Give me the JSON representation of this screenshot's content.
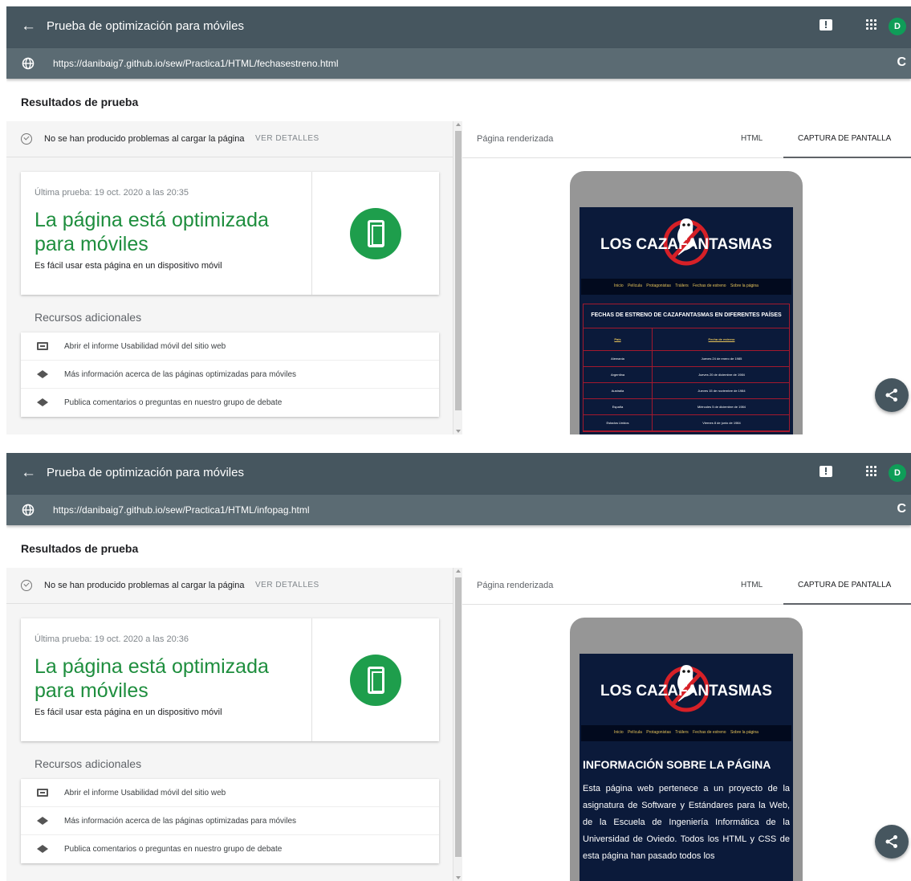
{
  "common": {
    "back_glyph": "←",
    "app_title": "Prueba de optimización para móviles",
    "avatar_letter": "D",
    "results_heading": "Resultados de prueba",
    "status_message": "No se han producido problemas al cargar la página",
    "details_link": "VER DETALLES",
    "headline": "La página está optimizada para móviles",
    "subline": "Es fácil usar esta página en un dispositivo móvil",
    "resources_heading": "Recursos adicionales",
    "resource_links": [
      "Abrir el informe Usabilidad móvil del sitio web",
      "Más información acerca de las páginas optimizadas para móviles",
      "Publica comentarios o preguntas en nuestro grupo de debate"
    ],
    "rendered_label": "Página renderizada",
    "tabs": [
      "HTML",
      "CAPTURA DE PANTALLA"
    ],
    "site_title": "LOS CAZAFANTASMAS",
    "site_nav": [
      "Inicio",
      "Película",
      "Protagonistas",
      "Tráilers",
      "Fechas de estreno",
      "Sobre la página"
    ],
    "reload_glyph": "C"
  },
  "captures": [
    {
      "url": "https://danibaig7.github.io/sew/Practica1/HTML/fechasestreno.html",
      "last_test": "Última prueba: 19 oct. 2020 a las 20:35",
      "table_caption": "FECHAS DE ESTRENO DE CAZAFANTASMAS EN DIFERENTES PAÍSES",
      "table_headers": [
        "País",
        "Fecha de estreno"
      ],
      "table_rows": [
        [
          "Alemania",
          "Jueves 24 de enero de 1985"
        ],
        [
          "Argentina",
          "Jueves 20 de diciembre de 1984"
        ],
        [
          "Australia",
          "Jueves 15 de noviembre de 1984"
        ],
        [
          "España",
          "Miércoles 5 de diciembre de 1984"
        ],
        [
          "Estados Unidos",
          "Viernes 8 de junio de 1984"
        ]
      ]
    },
    {
      "url": "https://danibaig7.github.io/sew/Practica1/HTML/infopag.html",
      "last_test": "Última prueba: 19 oct. 2020 a las 20:36",
      "info_heading": "INFORMACIÓN SOBRE LA PÁGINA",
      "info_text": "Esta página web pertenece a un proyecto de la asignatura de Software y Estándares para la Web, de la Escuela de Ingeniería Informática de la Universidad de Oviedo. Todos los HTML y CSS de esta página han pasado todos los"
    }
  ],
  "colors": {
    "topbar": "#46565f",
    "urlbar": "#5b6b73",
    "success_green": "#1e8e3e",
    "avatar_green": "#0f9d58",
    "site_background": "#0b1a3a",
    "site_accent_red": "#a3192e",
    "site_accent_gold": "#e6c35a"
  },
  "icons": [
    "back-arrow-icon",
    "feedback-icon",
    "apps-grid-icon",
    "globe-icon",
    "reload-icon",
    "check-circle-icon",
    "smartphone-icon",
    "report-icon",
    "graduation-cap-icon",
    "share-icon",
    "no-ghost-logo-icon"
  ]
}
